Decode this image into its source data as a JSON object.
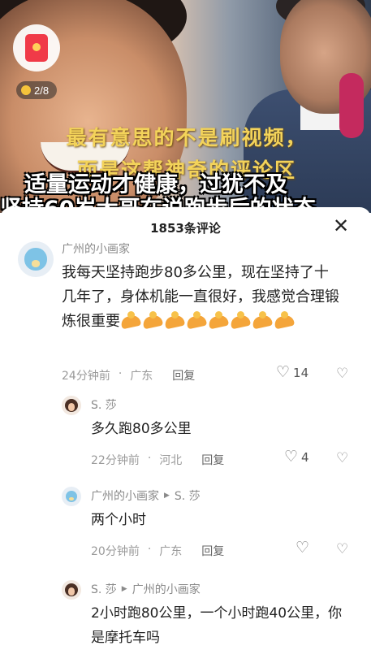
{
  "video": {
    "coin_counter": "2/8",
    "caption_line1": "最有意思的不是刷视频，",
    "caption_line2": "而是这帮神奇的评论区",
    "subtitle_line1": "适量运动才健康，过犹不及",
    "subtitle_line2": "坚持60岁大哥在说跑步后的状态"
  },
  "comments_panel": {
    "title": "1853条评论",
    "close_icon": "close-icon"
  },
  "comments": [
    {
      "author": "广州的小画家",
      "text": "我每天坚持跑步80多公里，现在坚持了十几年了，身体机能一直很好，我感觉合理锻炼很重要",
      "emoji_count": 8,
      "time": "24分钟前",
      "location": "广东",
      "reply_label": "回复",
      "likes": "14"
    },
    {
      "author": "S. 莎",
      "text": "多久跑80多公里",
      "time": "22分钟前",
      "location": "河北",
      "reply_label": "回复",
      "likes": "4"
    },
    {
      "author": "广州的小画家",
      "reply_to": "S. 莎",
      "text": "两个小时",
      "time": "20分钟前",
      "location": "广东",
      "reply_label": "回复",
      "likes": ""
    },
    {
      "author": "S. 莎",
      "reply_to": "广州的小画家",
      "text": "2小时跑80公里，一个小时跑40公里，你是摩托车吗"
    }
  ],
  "colors": {
    "caption_yellow": "#f3d35a",
    "meta_gray": "#9a9a9a",
    "text_dark": "#222222"
  }
}
